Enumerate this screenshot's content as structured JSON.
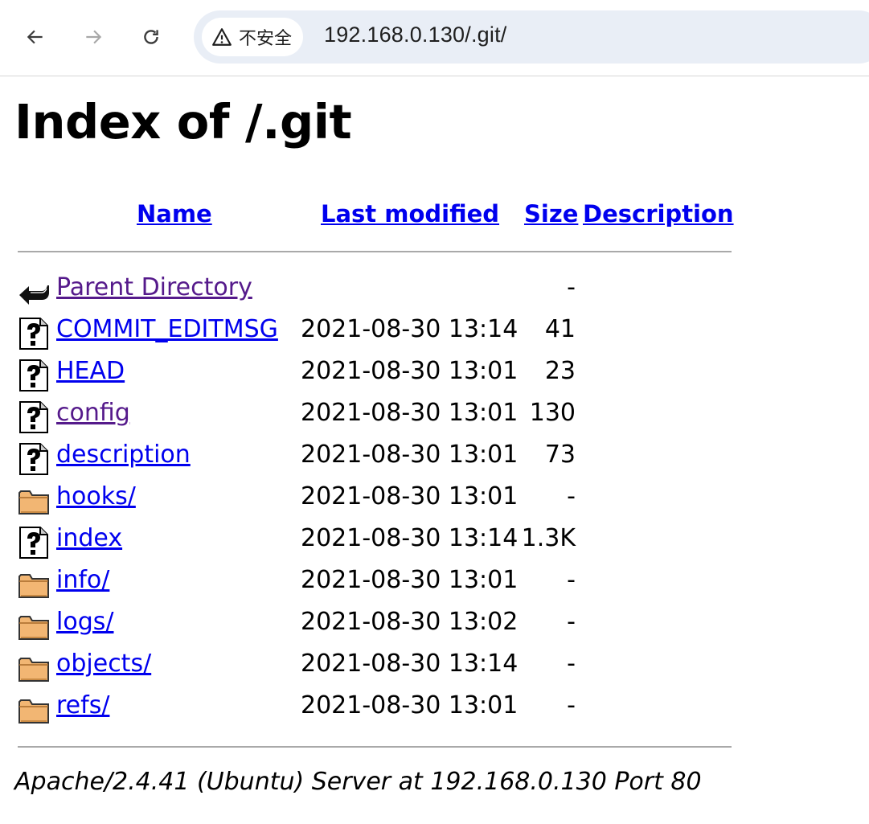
{
  "browser": {
    "security_label": "不安全",
    "url": "192.168.0.130/.git/"
  },
  "page": {
    "title": "Index of /.git",
    "columns": {
      "name": "Name",
      "last_modified": "Last modified",
      "size": "Size",
      "description": "Description"
    },
    "rows": [
      {
        "icon": "back-icon",
        "name": "Parent Directory",
        "date": "",
        "size": "-",
        "visited": true
      },
      {
        "icon": "unknown-file-icon",
        "name": "COMMIT_EDITMSG",
        "date": "2021-08-30 13:14",
        "size": "41",
        "visited": false
      },
      {
        "icon": "unknown-file-icon",
        "name": "HEAD",
        "date": "2021-08-30 13:01",
        "size": "23",
        "visited": false
      },
      {
        "icon": "unknown-file-icon",
        "name": "config",
        "date": "2021-08-30 13:01",
        "size": "130",
        "visited": true
      },
      {
        "icon": "unknown-file-icon",
        "name": "description",
        "date": "2021-08-30 13:01",
        "size": "73",
        "visited": false
      },
      {
        "icon": "folder-icon",
        "name": "hooks/",
        "date": "2021-08-30 13:01",
        "size": "-",
        "visited": false
      },
      {
        "icon": "unknown-file-icon",
        "name": "index",
        "date": "2021-08-30 13:14",
        "size": "1.3K",
        "visited": false
      },
      {
        "icon": "folder-icon",
        "name": "info/",
        "date": "2021-08-30 13:01",
        "size": "-",
        "visited": false
      },
      {
        "icon": "folder-icon",
        "name": "logs/",
        "date": "2021-08-30 13:02",
        "size": "-",
        "visited": false
      },
      {
        "icon": "folder-icon",
        "name": "objects/",
        "date": "2021-08-30 13:14",
        "size": "-",
        "visited": false
      },
      {
        "icon": "folder-icon",
        "name": "refs/",
        "date": "2021-08-30 13:01",
        "size": "-",
        "visited": false
      }
    ],
    "footer": "Apache/2.4.41 (Ubuntu) Server at 192.168.0.130 Port 80"
  }
}
